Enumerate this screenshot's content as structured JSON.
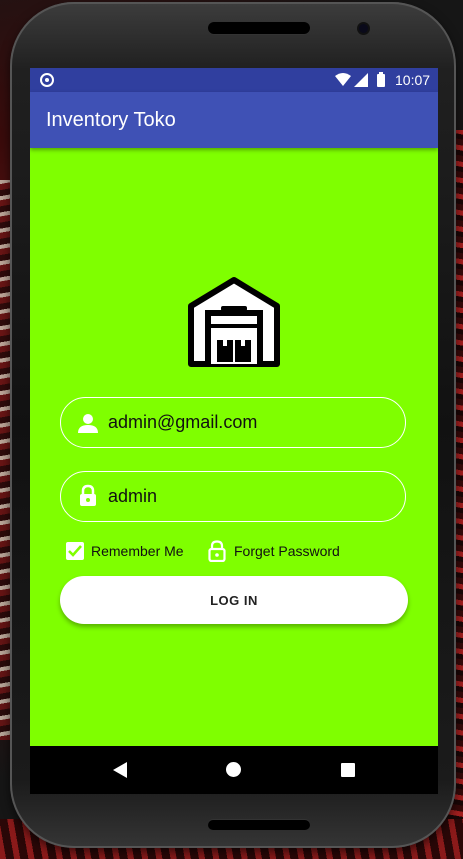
{
  "status_bar": {
    "time": "10:07",
    "icons": [
      "notification-icon",
      "wifi-icon",
      "signal-icon",
      "battery-icon"
    ]
  },
  "app_bar": {
    "title": "Inventory Toko",
    "color": "#3f51b5",
    "status_color": "#303f9f"
  },
  "content": {
    "background": "#7fff00",
    "logo_icon": "warehouse-icon"
  },
  "login_form": {
    "email": {
      "value": "admin@gmail.com",
      "icon": "person-icon"
    },
    "password": {
      "value": "admin",
      "icon": "lock-icon"
    },
    "remember_me": {
      "label": "Remember Me",
      "checked": true
    },
    "forget_password": {
      "label": "Forget Password",
      "icon": "unlock-icon"
    },
    "login_button": {
      "label": "LOG IN"
    }
  },
  "nav_bar": {
    "icons": [
      "back-icon",
      "home-icon",
      "recents-icon"
    ]
  }
}
